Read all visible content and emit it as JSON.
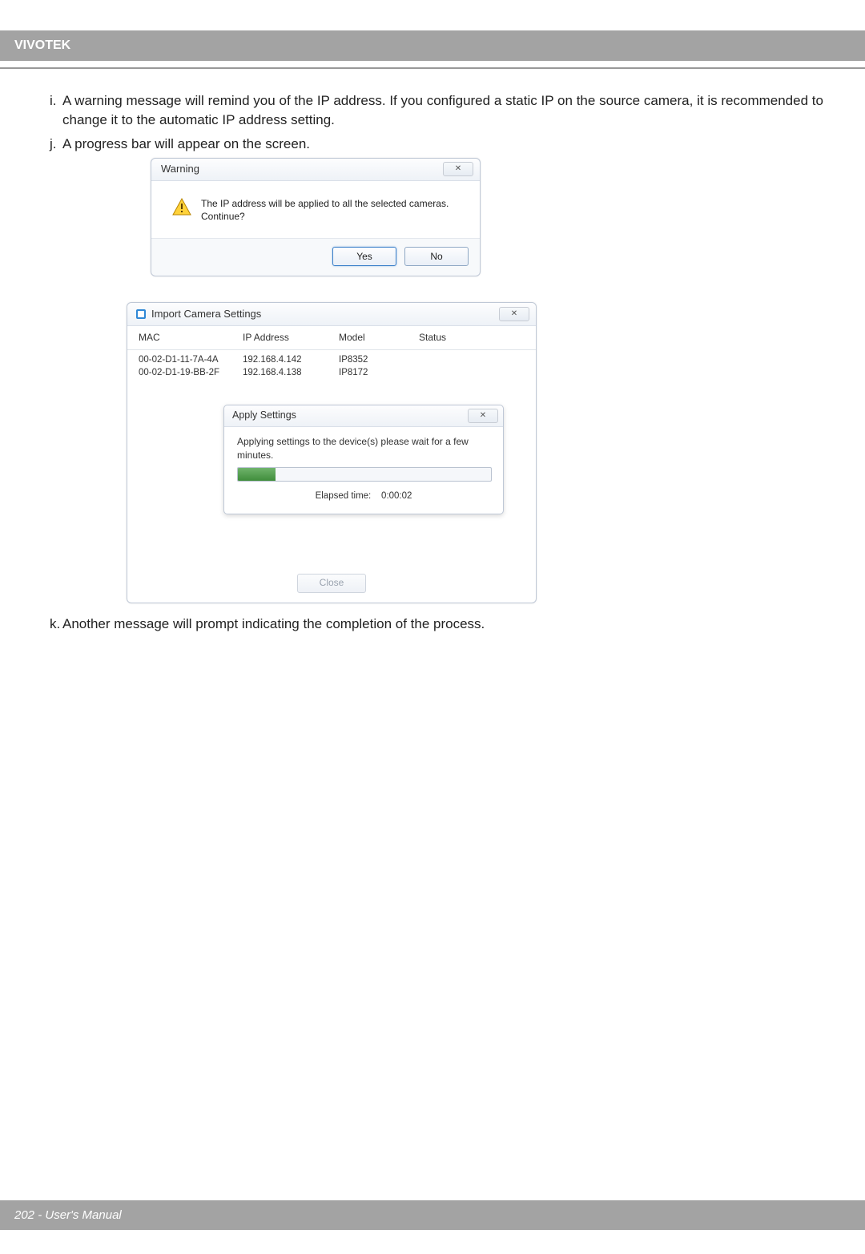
{
  "header": {
    "brand": "VIVOTEK"
  },
  "steps": {
    "i_letter": "i.",
    "i_text": "A warning message will remind you of the IP address. If you configured a static IP on the source camera, it is recommended to change it to the automatic IP address setting.",
    "j_letter": "j.",
    "j_text": "A progress bar will appear on the screen.",
    "k_letter": "k.",
    "k_text": "Another message will prompt indicating the completion of the process."
  },
  "warning_dialog": {
    "title": "Warning",
    "close_glyph": "✕",
    "message": "The IP address will be applied to all the selected cameras. Continue?",
    "yes": "Yes",
    "no": "No"
  },
  "import_dialog": {
    "title": "Import Camera Settings",
    "close_glyph": "✕",
    "columns": {
      "mac": "MAC",
      "ip": "IP Address",
      "model": "Model",
      "status": "Status"
    },
    "rows": [
      {
        "mac": "00-02-D1-11-7A-4A",
        "ip": "192.168.4.142",
        "model": "IP8352",
        "status": ""
      },
      {
        "mac": "00-02-D1-19-BB-2F",
        "ip": "192.168.4.138",
        "model": "IP8172",
        "status": ""
      }
    ],
    "apply": {
      "title": "Apply Settings",
      "close_glyph": "✕",
      "message": "Applying settings to the device(s) please wait for a few minutes.",
      "elapsed_label": "Elapsed time:",
      "elapsed_value": "0:00:02"
    },
    "close_label": "Close"
  },
  "footer": {
    "text": "202 - User's Manual"
  }
}
